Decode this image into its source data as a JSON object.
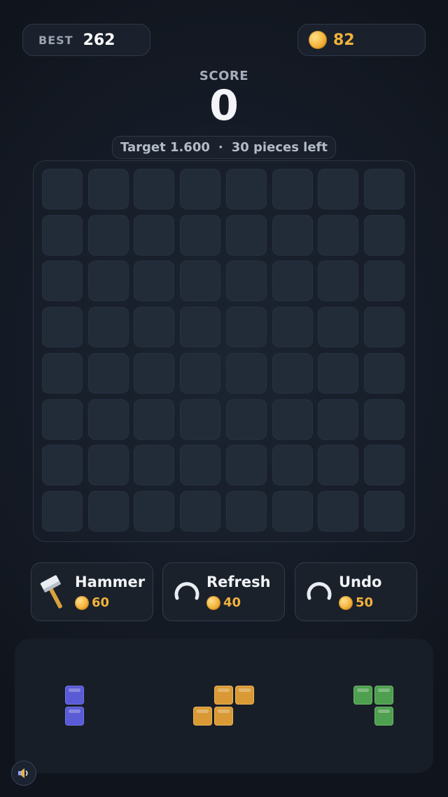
{
  "header": {
    "best_label": "BEST",
    "best_value": "262",
    "coins": "82"
  },
  "score": {
    "label": "SCORE",
    "value": "0"
  },
  "target": {
    "target_text": "Target 1.600",
    "separator": "·",
    "pieces_text": "30 pieces left"
  },
  "board": {
    "rows": 8,
    "cols": 8,
    "filled_cells": 0
  },
  "tools": [
    {
      "name": "Hammer",
      "cost": "60",
      "icon": "hammer-icon"
    },
    {
      "name": "Refresh",
      "cost": "40",
      "icon": "refresh-icon"
    },
    {
      "name": "Undo",
      "cost": "50",
      "icon": "undo-icon"
    }
  ],
  "pieces": [
    {
      "color": "blue",
      "hex": "#5a5bd6",
      "shape": "vertical domino"
    },
    {
      "color": "orange",
      "hex": "#d99a35",
      "shape": "S tetromino"
    },
    {
      "color": "green",
      "hex": "#4f9f50",
      "shape": "L tromino"
    }
  ],
  "colors": {
    "accent_coin": "#f2b23b",
    "background": "#151b26"
  },
  "sound": {
    "icon": "speaker-icon"
  }
}
